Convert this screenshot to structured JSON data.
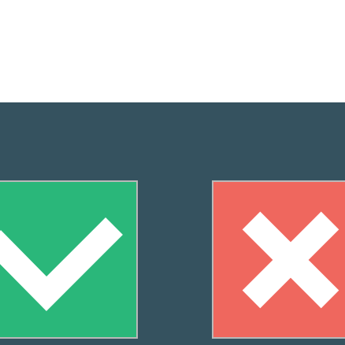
{
  "colors": {
    "background_top": "#ffffff",
    "panel": "#35525f",
    "accept": "#2ab77a",
    "reject": "#ef675e",
    "border": "#b9b9b9"
  },
  "buttons": [
    {
      "icon": "checkmark-icon",
      "action": "accept"
    },
    {
      "icon": "x-icon",
      "action": "reject"
    }
  ]
}
